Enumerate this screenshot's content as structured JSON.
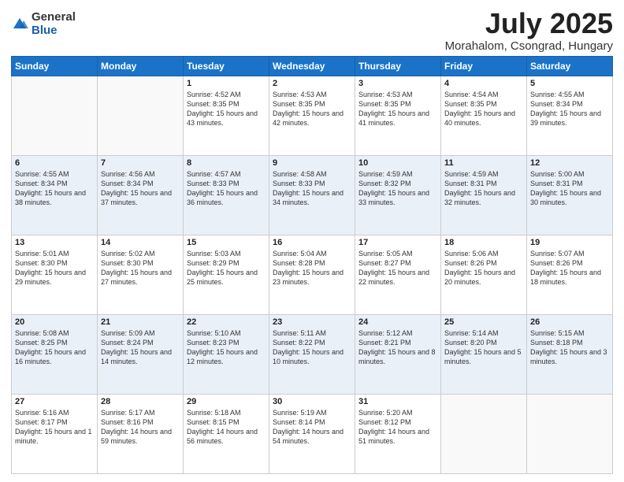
{
  "header": {
    "logo_general": "General",
    "logo_blue": "Blue",
    "main_title": "July 2025",
    "subtitle": "Morahalom, Csongrad, Hungary"
  },
  "weekdays": [
    "Sunday",
    "Monday",
    "Tuesday",
    "Wednesday",
    "Thursday",
    "Friday",
    "Saturday"
  ],
  "weeks": [
    [
      {
        "day": "",
        "sunrise": "",
        "sunset": "",
        "daylight": ""
      },
      {
        "day": "",
        "sunrise": "",
        "sunset": "",
        "daylight": ""
      },
      {
        "day": "1",
        "sunrise": "Sunrise: 4:52 AM",
        "sunset": "Sunset: 8:35 PM",
        "daylight": "Daylight: 15 hours and 43 minutes."
      },
      {
        "day": "2",
        "sunrise": "Sunrise: 4:53 AM",
        "sunset": "Sunset: 8:35 PM",
        "daylight": "Daylight: 15 hours and 42 minutes."
      },
      {
        "day": "3",
        "sunrise": "Sunrise: 4:53 AM",
        "sunset": "Sunset: 8:35 PM",
        "daylight": "Daylight: 15 hours and 41 minutes."
      },
      {
        "day": "4",
        "sunrise": "Sunrise: 4:54 AM",
        "sunset": "Sunset: 8:35 PM",
        "daylight": "Daylight: 15 hours and 40 minutes."
      },
      {
        "day": "5",
        "sunrise": "Sunrise: 4:55 AM",
        "sunset": "Sunset: 8:34 PM",
        "daylight": "Daylight: 15 hours and 39 minutes."
      }
    ],
    [
      {
        "day": "6",
        "sunrise": "Sunrise: 4:55 AM",
        "sunset": "Sunset: 8:34 PM",
        "daylight": "Daylight: 15 hours and 38 minutes."
      },
      {
        "day": "7",
        "sunrise": "Sunrise: 4:56 AM",
        "sunset": "Sunset: 8:34 PM",
        "daylight": "Daylight: 15 hours and 37 minutes."
      },
      {
        "day": "8",
        "sunrise": "Sunrise: 4:57 AM",
        "sunset": "Sunset: 8:33 PM",
        "daylight": "Daylight: 15 hours and 36 minutes."
      },
      {
        "day": "9",
        "sunrise": "Sunrise: 4:58 AM",
        "sunset": "Sunset: 8:33 PM",
        "daylight": "Daylight: 15 hours and 34 minutes."
      },
      {
        "day": "10",
        "sunrise": "Sunrise: 4:59 AM",
        "sunset": "Sunset: 8:32 PM",
        "daylight": "Daylight: 15 hours and 33 minutes."
      },
      {
        "day": "11",
        "sunrise": "Sunrise: 4:59 AM",
        "sunset": "Sunset: 8:31 PM",
        "daylight": "Daylight: 15 hours and 32 minutes."
      },
      {
        "day": "12",
        "sunrise": "Sunrise: 5:00 AM",
        "sunset": "Sunset: 8:31 PM",
        "daylight": "Daylight: 15 hours and 30 minutes."
      }
    ],
    [
      {
        "day": "13",
        "sunrise": "Sunrise: 5:01 AM",
        "sunset": "Sunset: 8:30 PM",
        "daylight": "Daylight: 15 hours and 29 minutes."
      },
      {
        "day": "14",
        "sunrise": "Sunrise: 5:02 AM",
        "sunset": "Sunset: 8:30 PM",
        "daylight": "Daylight: 15 hours and 27 minutes."
      },
      {
        "day": "15",
        "sunrise": "Sunrise: 5:03 AM",
        "sunset": "Sunset: 8:29 PM",
        "daylight": "Daylight: 15 hours and 25 minutes."
      },
      {
        "day": "16",
        "sunrise": "Sunrise: 5:04 AM",
        "sunset": "Sunset: 8:28 PM",
        "daylight": "Daylight: 15 hours and 23 minutes."
      },
      {
        "day": "17",
        "sunrise": "Sunrise: 5:05 AM",
        "sunset": "Sunset: 8:27 PM",
        "daylight": "Daylight: 15 hours and 22 minutes."
      },
      {
        "day": "18",
        "sunrise": "Sunrise: 5:06 AM",
        "sunset": "Sunset: 8:26 PM",
        "daylight": "Daylight: 15 hours and 20 minutes."
      },
      {
        "day": "19",
        "sunrise": "Sunrise: 5:07 AM",
        "sunset": "Sunset: 8:26 PM",
        "daylight": "Daylight: 15 hours and 18 minutes."
      }
    ],
    [
      {
        "day": "20",
        "sunrise": "Sunrise: 5:08 AM",
        "sunset": "Sunset: 8:25 PM",
        "daylight": "Daylight: 15 hours and 16 minutes."
      },
      {
        "day": "21",
        "sunrise": "Sunrise: 5:09 AM",
        "sunset": "Sunset: 8:24 PM",
        "daylight": "Daylight: 15 hours and 14 minutes."
      },
      {
        "day": "22",
        "sunrise": "Sunrise: 5:10 AM",
        "sunset": "Sunset: 8:23 PM",
        "daylight": "Daylight: 15 hours and 12 minutes."
      },
      {
        "day": "23",
        "sunrise": "Sunrise: 5:11 AM",
        "sunset": "Sunset: 8:22 PM",
        "daylight": "Daylight: 15 hours and 10 minutes."
      },
      {
        "day": "24",
        "sunrise": "Sunrise: 5:12 AM",
        "sunset": "Sunset: 8:21 PM",
        "daylight": "Daylight: 15 hours and 8 minutes."
      },
      {
        "day": "25",
        "sunrise": "Sunrise: 5:14 AM",
        "sunset": "Sunset: 8:20 PM",
        "daylight": "Daylight: 15 hours and 5 minutes."
      },
      {
        "day": "26",
        "sunrise": "Sunrise: 5:15 AM",
        "sunset": "Sunset: 8:18 PM",
        "daylight": "Daylight: 15 hours and 3 minutes."
      }
    ],
    [
      {
        "day": "27",
        "sunrise": "Sunrise: 5:16 AM",
        "sunset": "Sunset: 8:17 PM",
        "daylight": "Daylight: 15 hours and 1 minute."
      },
      {
        "day": "28",
        "sunrise": "Sunrise: 5:17 AM",
        "sunset": "Sunset: 8:16 PM",
        "daylight": "Daylight: 14 hours and 59 minutes."
      },
      {
        "day": "29",
        "sunrise": "Sunrise: 5:18 AM",
        "sunset": "Sunset: 8:15 PM",
        "daylight": "Daylight: 14 hours and 56 minutes."
      },
      {
        "day": "30",
        "sunrise": "Sunrise: 5:19 AM",
        "sunset": "Sunset: 8:14 PM",
        "daylight": "Daylight: 14 hours and 54 minutes."
      },
      {
        "day": "31",
        "sunrise": "Sunrise: 5:20 AM",
        "sunset": "Sunset: 8:12 PM",
        "daylight": "Daylight: 14 hours and 51 minutes."
      },
      {
        "day": "",
        "sunrise": "",
        "sunset": "",
        "daylight": ""
      },
      {
        "day": "",
        "sunrise": "",
        "sunset": "",
        "daylight": ""
      }
    ]
  ]
}
